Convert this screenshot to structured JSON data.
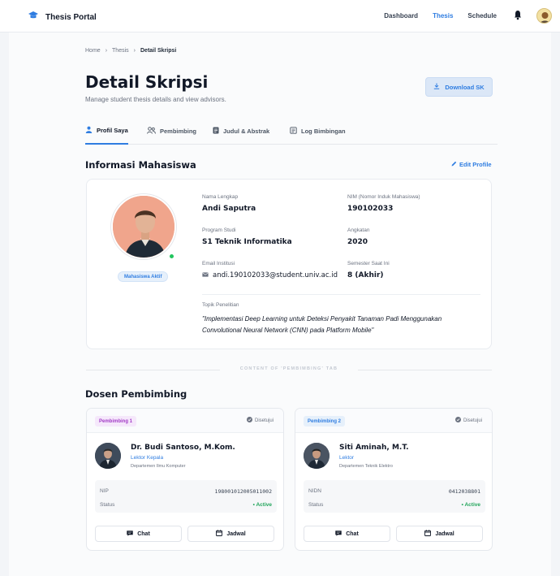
{
  "app": {
    "title": "Thesis Portal"
  },
  "nav": {
    "items": [
      "Dashboard",
      "Thesis",
      "Schedule"
    ],
    "active": "Thesis"
  },
  "breadcrumb": [
    "Home",
    "Thesis",
    "Detail Skripsi"
  ],
  "page": {
    "title": "Detail Skripsi",
    "subtitle": "Manage student thesis details and view advisors.",
    "download_label": "Download SK"
  },
  "tabs": [
    {
      "label": "Profil Saya",
      "icon": "user-icon"
    },
    {
      "label": "Pembimbing",
      "icon": "users-icon"
    },
    {
      "label": "Judul & Abstrak",
      "icon": "document-icon"
    },
    {
      "label": "Log Bimbingan",
      "icon": "log-icon"
    }
  ],
  "student_section": {
    "title": "Informasi Mahasiswa",
    "edit_label": "Edit Profile",
    "status": "Mahasiswa Aktif",
    "fields": {
      "name": {
        "label": "Nama Lengkap",
        "value": "Andi Saputra"
      },
      "nim": {
        "label": "NIM (Nomor Induk Mahasiswa)",
        "value": "190102033"
      },
      "program": {
        "label": "Program Studi",
        "value": "S1 Teknik Informatika"
      },
      "year": {
        "label": "Angkatan",
        "value": "2020"
      },
      "email": {
        "label": "Email Institusi",
        "value": "andi.190102033@student.univ.ac.id"
      },
      "semester": {
        "label": "Semester Saat Ini",
        "value": "8 (Akhir)"
      }
    },
    "topic": {
      "label": "Topik Penelitian",
      "value": "\"Implementasi Deep Learning untuk Deteksi Penyakit Tanaman Padi Menggunakan Convolutional Neural Network (CNN) pada Platform Mobile\""
    }
  },
  "content_separator": "CONTENT OF 'PEMBIMBING' TAB",
  "advisor_section": {
    "title": "Dosen Pembimbing",
    "advisors": [
      {
        "tag": "Pembimbing 1",
        "approved": "Disetujui",
        "name": "Dr. Budi Santoso, M.Kom.",
        "role": "Lektor Kepala",
        "department": "Departemen Ilmu Komputer",
        "id_label": "NIP",
        "id_value": "198001012005011002",
        "status_label": "Status",
        "status_value": "• Active",
        "chat_label": "Chat",
        "schedule_label": "Jadwal"
      },
      {
        "tag": "Pembimbing 2",
        "approved": "Disetujui",
        "name": "Siti Aminah, M.T.",
        "role": "Lektor",
        "department": "Departemen Teknik Elektro",
        "id_label": "NIDN",
        "id_value": "0412038801",
        "status_label": "Status",
        "status_value": "• Active",
        "chat_label": "Chat",
        "schedule_label": "Jadwal"
      }
    ]
  },
  "colors": {
    "accent": "#2f7de1",
    "success": "#22c55e",
    "tag1_bg": "#f5e8fb",
    "tag1_text": "#a23bc6",
    "tag2_bg": "#e6f0fb",
    "tag2_text": "#2f7de1"
  }
}
